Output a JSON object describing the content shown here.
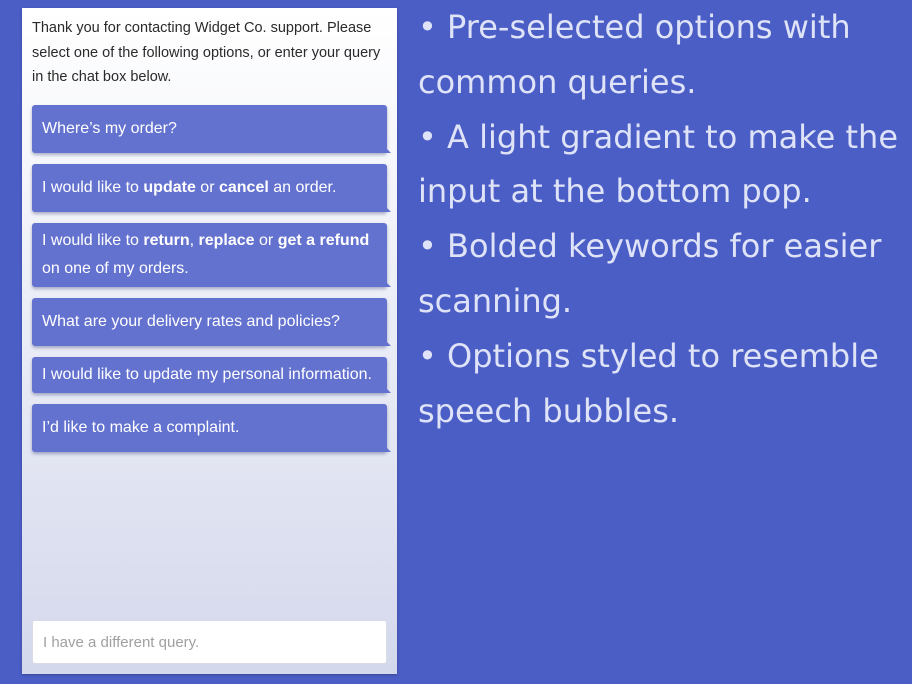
{
  "chat": {
    "intro": "Thank you for contacting Widget Co. support. Please select one of the following options, or enter your query in the chat box below.",
    "options": [
      {
        "id": "order",
        "parts": [
          {
            "text": "Where’s my order?",
            "bold": false
          }
        ]
      },
      {
        "id": "update-cancel",
        "parts": [
          {
            "text": "I would like to ",
            "bold": false
          },
          {
            "text": "update",
            "bold": true
          },
          {
            "text": " or ",
            "bold": false
          },
          {
            "text": "cancel",
            "bold": true
          },
          {
            "text": " an order.",
            "bold": false
          }
        ]
      },
      {
        "id": "return-refund",
        "parts": [
          {
            "text": "I would like to ",
            "bold": false
          },
          {
            "text": "return",
            "bold": true
          },
          {
            "text": ", ",
            "bold": false
          },
          {
            "text": "replace",
            "bold": true
          },
          {
            "text": " or ",
            "bold": false
          },
          {
            "text": "get a refund",
            "bold": true
          },
          {
            "text": " on one of my orders.",
            "bold": false
          }
        ]
      },
      {
        "id": "delivery",
        "parts": [
          {
            "text": "What are your delivery rates and policies?",
            "bold": false
          }
        ]
      },
      {
        "id": "personal-info",
        "parts": [
          {
            "text": "I would like to update my personal information.",
            "bold": false
          }
        ]
      },
      {
        "id": "complaint",
        "parts": [
          {
            "text": "I’d like to make a complaint.",
            "bold": false
          }
        ]
      }
    ],
    "input_placeholder": "I have a different query."
  },
  "bullets": [
    "• Pre-selected options with common queries.",
    "• A light gradient to make the input at the bottom pop.",
    "• Bolded keywords for easier scanning.",
    "• Options styled to resemble speech bubbles."
  ],
  "colors": {
    "background": "#4b5ec6",
    "option_bubble": "#6472cf",
    "bullet_text": "#dfe3f7"
  }
}
